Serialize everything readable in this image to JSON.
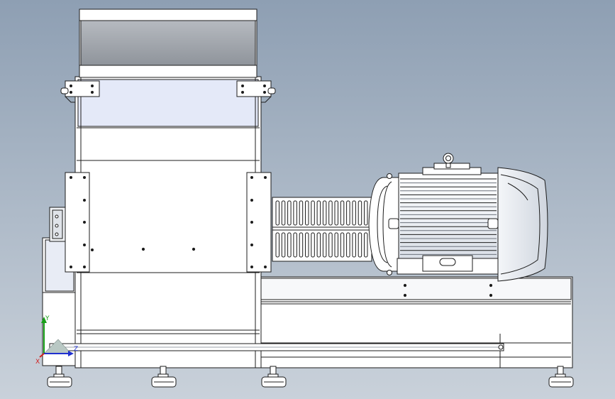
{
  "viewport": {
    "background_top": "#8e9fb3",
    "background_bottom": "#c9d1da",
    "outline_color": "#1c1c1c",
    "body_fill": "#ffffff",
    "hopper_fill": "#9ea3aa",
    "hopper_upper_fill": "#e4e9f8",
    "motor_fill": "#f2f4f7"
  },
  "triad": {
    "x_label": "X",
    "y_label": "Y",
    "z_label": "Z",
    "x_color": "#d22020",
    "y_color": "#18a018",
    "z_color": "#2030d0"
  }
}
